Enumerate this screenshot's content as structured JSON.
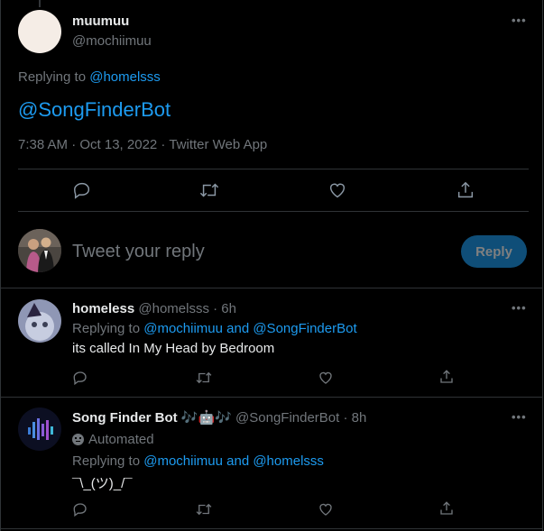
{
  "main_tweet": {
    "display_name": "muumuu",
    "handle": "@mochiimuu",
    "replying_prefix": "Replying to",
    "replying_to": "@homelsss",
    "text": "@SongFinderBot",
    "meta": "7:38 AM · Oct 13, 2022 · Twitter Web App"
  },
  "reply_box": {
    "placeholder": "Tweet your reply",
    "button_label": "Reply"
  },
  "replies": [
    {
      "display_name": "homeless",
      "handle_time": "@homelsss · 6h",
      "replying_prefix": "Replying to",
      "replying_to": "@mochiimuu and @SongFinderBot",
      "text": "its called In My Head by Bedroom"
    },
    {
      "display_name": "Song Finder Bot 🎶🤖🎶",
      "handle_time": "@SongFinderBot · 8h",
      "automated_label": "Automated",
      "replying_prefix": "Replying to",
      "replying_to": "@mochiimuu and @homelsss",
      "text": "¯\\_(ツ)_/¯"
    }
  ],
  "colors": {
    "accent": "#1d9bf0",
    "background": "#000000",
    "muted": "#71767b",
    "divider": "#2f3336"
  }
}
